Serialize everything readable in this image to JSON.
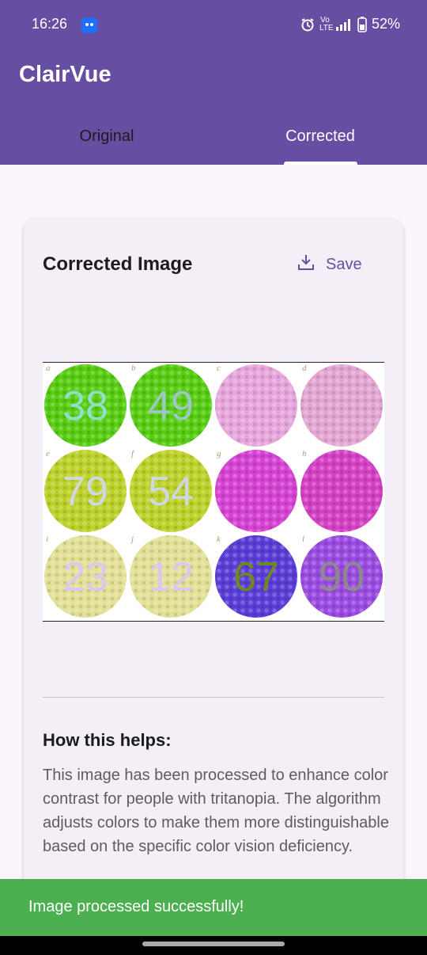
{
  "status_bar": {
    "time": "16:26",
    "volte": "Vo LTE",
    "battery": "52%"
  },
  "app": {
    "title": "ClairVue",
    "brand_color": "#664ea3"
  },
  "tabs": [
    {
      "label": "Original",
      "selected": false
    },
    {
      "label": "Corrected",
      "selected": true
    }
  ],
  "card": {
    "title": "Corrected Image",
    "save_label": "Save",
    "image_letters": [
      "a",
      "b",
      "c",
      "d",
      "e",
      "f",
      "g",
      "h",
      "i",
      "j",
      "k",
      "l"
    ],
    "image_numbers": [
      "38",
      "49",
      "",
      "",
      "79",
      "54",
      "",
      "",
      "23",
      "12",
      "67",
      "90"
    ],
    "help_heading": "How this helps:",
    "help_text": "This image has been processed to enhance color contrast for people with tritanopia. The algorithm adjusts colors to make them more distinguishable based on the specific color vision deficiency."
  },
  "snackbar": {
    "message": "Image processed successfully!",
    "color": "#4caf50"
  }
}
